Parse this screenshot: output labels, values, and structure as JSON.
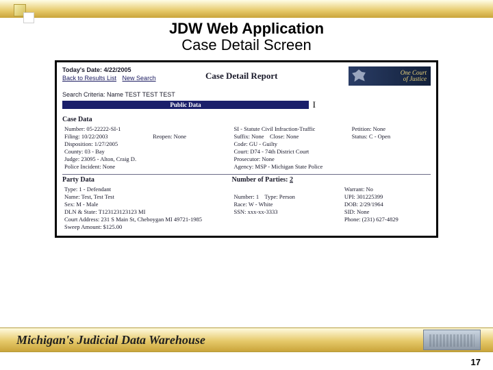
{
  "title": {
    "line1": "JDW Web Application",
    "line2": "Case Detail Screen"
  },
  "header": {
    "today_label": "Today's Date:",
    "today_value": "4/22/2005",
    "back_link": "Back to Results List",
    "new_search": "New Search",
    "report_title": "Case Detail Report",
    "logo_text1": "One Court",
    "logo_text2": "of Justice"
  },
  "criteria": {
    "label": "Search Criteria:",
    "value": "Name TEST TEST TEST"
  },
  "public_data_label": "Public Data",
  "case": {
    "section": "Case Data",
    "r1": {
      "number_l": "Number:",
      "number_v": "05-22222-SI-1",
      "si_text": "SI - Statute Civil Infraction-Traffic",
      "petition_l": "Petition:",
      "petition_v": "None"
    },
    "r2": {
      "filing_l": "Filing:",
      "filing_v": "10/22/2003",
      "reopen_l": "Reopen:",
      "reopen_v": "None",
      "suffix_l": "Suffix:",
      "suffix_v": "None",
      "close_l": "Close:",
      "close_v": "None",
      "status_l": "Status:",
      "status_v": "C - Open"
    },
    "r3": {
      "disp_l": "Disposition:",
      "disp_v": "1/27/2005",
      "code_l": "Code:",
      "code_v": "GU - Guilty"
    },
    "r4": {
      "county_l": "County:",
      "county_v": "03 - Bay",
      "court_l": "Court:",
      "court_v": "D74 - 74th District Court"
    },
    "r5": {
      "judge_l": "Judge:",
      "judge_v": "23095 - Alton, Craig D.",
      "pros_l": "Prosecutor:",
      "pros_v": "None"
    },
    "r6": {
      "police_l": "Police Incident:",
      "police_v": "None",
      "agency_l": "Agency:",
      "agency_v": "MSP - Michigan State Police"
    }
  },
  "party": {
    "section": "Party Data",
    "nop_label": "Number of Parties:",
    "nop_value": "2",
    "r1": {
      "type_l": "Type:",
      "type_v": "1 - Defendant",
      "warrant_l": "Warrant:",
      "warrant_v": "No"
    },
    "r2": {
      "name_l": "Name:",
      "name_v": "Test, Test Test",
      "number_l": "Number:",
      "number_v": "1",
      "ptype_l": "Type:",
      "ptype_v": "Person",
      "upi_l": "UPI:",
      "upi_v": "301225399"
    },
    "r3": {
      "sex_l": "Sex:",
      "sex_v": "M - Male",
      "race_l": "Race:",
      "race_v": "W - White",
      "dob_l": "DOB:",
      "dob_v": "2/29/1964"
    },
    "r4": {
      "dln_l": "DLN & State:",
      "dln_v": "T123123123123 MI",
      "ssn_l": "SSN:",
      "ssn_v": "xxx-xx-3333",
      "sid_l": "SID:",
      "sid_v": "None"
    },
    "r5": {
      "addr_l": "Court Address:",
      "addr_v": "231 S Main St, Cheboygan MI 49721-1985",
      "phone_l": "Phone:",
      "phone_v": "(231) 627-4829"
    },
    "r6": {
      "sweep_l": "Sweep Amount:",
      "sweep_v": "$125.00"
    }
  },
  "footer": {
    "text": "Michigan's Judicial Data Warehouse"
  },
  "page_number": "17"
}
